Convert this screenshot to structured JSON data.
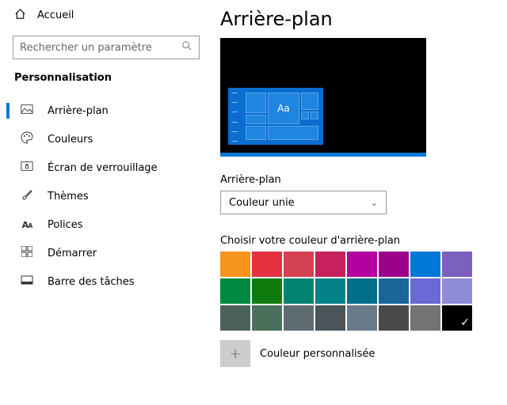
{
  "sidebar": {
    "home": "Accueil",
    "search_placeholder": "Rechercher un paramètre",
    "section": "Personnalisation",
    "items": [
      {
        "label": "Arrière-plan",
        "icon": "picture-icon",
        "selected": true
      },
      {
        "label": "Couleurs",
        "icon": "palette-icon",
        "selected": false
      },
      {
        "label": "Écran de verrouillage",
        "icon": "lock-icon",
        "selected": false
      },
      {
        "label": "Thèmes",
        "icon": "brush-icon",
        "selected": false
      },
      {
        "label": "Polices",
        "icon": "fonts-icon",
        "selected": false
      },
      {
        "label": "Démarrer",
        "icon": "start-icon",
        "selected": false
      },
      {
        "label": "Barre des tâches",
        "icon": "taskbar-icon",
        "selected": false
      }
    ]
  },
  "page": {
    "title": "Arrière-plan",
    "preview_aa": "Aa",
    "bg_label": "Arrière-plan",
    "bg_value": "Couleur unie",
    "swatch_label": "Choisir votre couleur d'arrière-plan",
    "custom_label": "Couleur personnalisée",
    "plus": "+",
    "colors_row1": [
      "#f7941d",
      "#e5323e",
      "#d44054",
      "#c6215c",
      "#b4009e",
      "#9a0089",
      "#0078d7",
      "#7b60c0"
    ],
    "colors_row2": [
      "#00893e",
      "#107c10",
      "#008272",
      "#038387",
      "#00708a",
      "#1a6699",
      "#6b69d6",
      "#8e8cd8"
    ],
    "colors_row3": [
      "#4b6159",
      "#49705b",
      "#5f6b73",
      "#4a5459",
      "#697a8b",
      "#4c4a48",
      "#737373",
      "#000000"
    ],
    "selected_color": "#000000"
  }
}
